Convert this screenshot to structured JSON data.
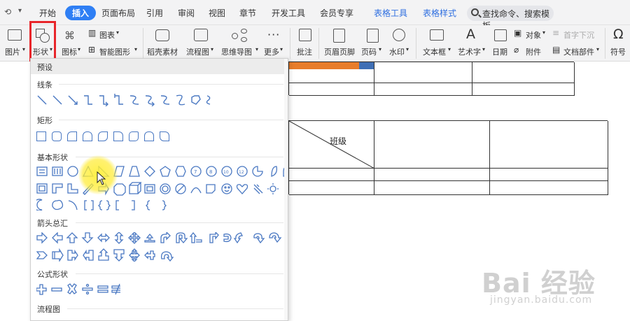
{
  "menubar": {
    "tabs": [
      "开始",
      "插入",
      "页面布局",
      "引用",
      "审阅",
      "视图",
      "章节",
      "开发工具",
      "会员专享",
      "表格工具",
      "表格样式"
    ],
    "active_tab": "插入",
    "search_placeholder": "查找命令、搜索模板"
  },
  "ribbon": {
    "picture": "图片",
    "shape": "形状",
    "icon": "图标",
    "chart": "图表",
    "smart_graphic": "智能图形",
    "stock_material": "稻壳素材",
    "flowchart": "流程图",
    "mindmap": "思维导图",
    "more": "更多",
    "comment": "批注",
    "header_footer": "页眉页脚",
    "page_number": "页码",
    "watermark": "水印",
    "textbox": "文本框",
    "wordart": "艺术字",
    "date": "日期",
    "object": "对象",
    "dropcap": "首字下沉",
    "attachment": "附件",
    "doc_parts": "文档部件",
    "symbol": "符号"
  },
  "document": {
    "header_text": "班级"
  },
  "shapes_panel": {
    "preset": "预设",
    "sections": [
      "线条",
      "矩形",
      "基本形状",
      "箭头总汇",
      "公式形状",
      "流程图"
    ]
  },
  "watermark": {
    "brand": "Bai 经验",
    "url": "jingyan.baidu.com"
  },
  "colors": {
    "accent": "#2f7ff4",
    "highlight_border": "#e8262b",
    "shape_outline": "#4a78c2"
  }
}
